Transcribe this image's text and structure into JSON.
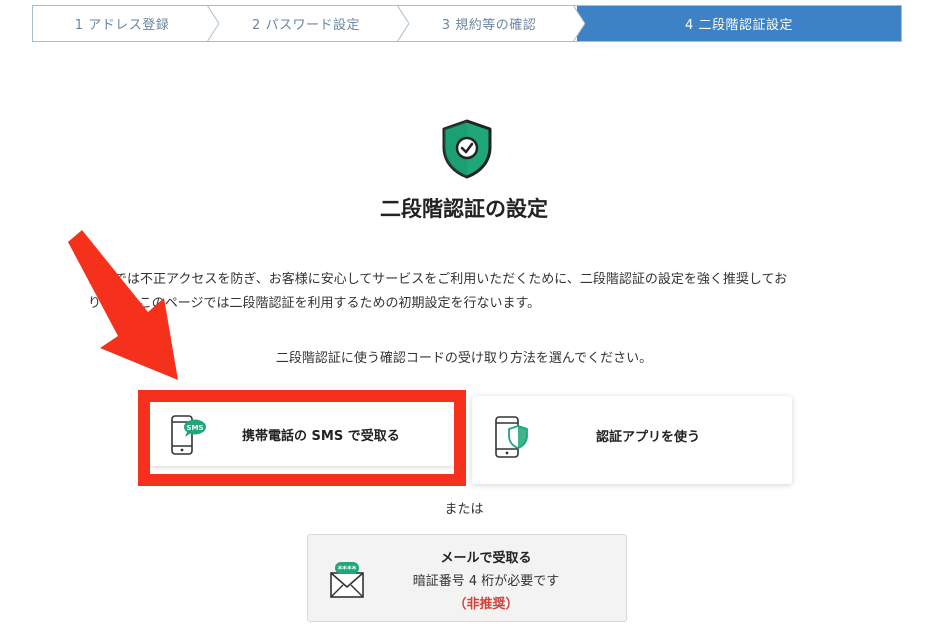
{
  "stepper": {
    "steps": [
      {
        "label": "1 アドレス登録",
        "active": false
      },
      {
        "label": "2 パスワード設定",
        "active": false
      },
      {
        "label": "3 規約等の確認",
        "active": false
      },
      {
        "label": "4 二段階認証設定",
        "active": true
      }
    ]
  },
  "header": {
    "icon": "shield-check-icon",
    "title": "二段階認証の設定"
  },
  "description": {
    "line1": "当社では不正アクセスを防ぎ、お客様に安心してサービスをご利用いただくために、二段階認証の設定を強く推奨してお",
    "line2": "ります。このページでは二段階認証を利用するための初期設定を行ないます。"
  },
  "instruction": "二段階認証に使う確認コードの受け取り方法を選んでください。",
  "options": {
    "sms": {
      "label": "携帯電話の SMS で受取る",
      "icon": "phone-sms-icon"
    },
    "app": {
      "label": "認証アプリを使う",
      "icon": "phone-shield-icon"
    },
    "or_text": "または",
    "mail": {
      "title": "メールで受取る",
      "subtitle": "暗証番号 4 桁が必要です",
      "note": "（非推奨）",
      "icon": "envelope-password-icon"
    }
  },
  "colors": {
    "active_step": "#3d82c4",
    "step_text": "#6b86a3",
    "shield_green": "#1fa67a",
    "highlight_red": "#f5311b",
    "not_recommended": "#d0443b"
  }
}
